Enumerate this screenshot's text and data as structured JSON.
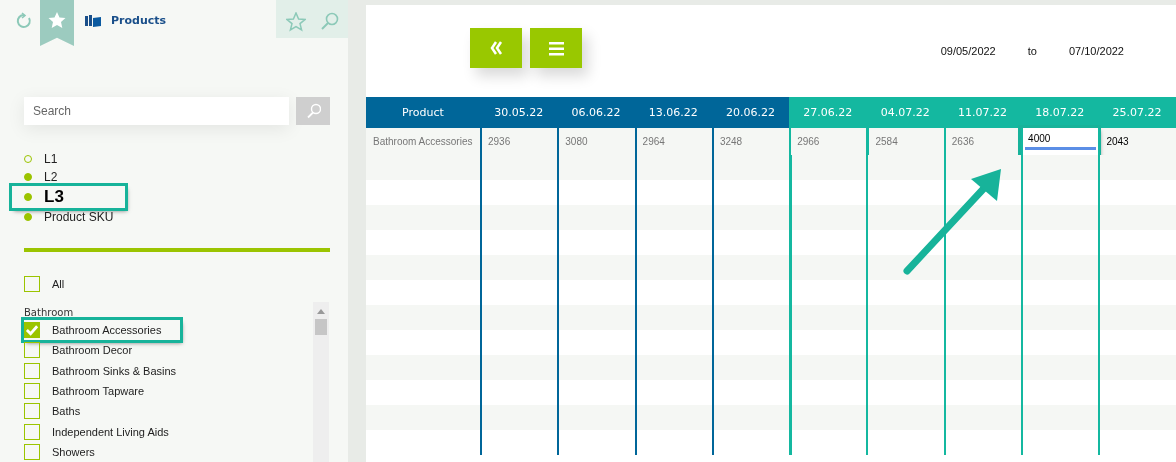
{
  "sidebar": {
    "title": "Products",
    "bookmark_selected": true,
    "search": {
      "placeholder": "Search"
    },
    "levels": [
      {
        "label": "L1",
        "filled": false,
        "selected": false,
        "highlighted": false
      },
      {
        "label": "L2",
        "filled": true,
        "selected": false,
        "highlighted": false
      },
      {
        "label": "L3",
        "filled": true,
        "selected": true,
        "highlighted": true
      },
      {
        "label": "Product SKU",
        "filled": true,
        "selected": false,
        "highlighted": false
      }
    ],
    "all": {
      "label": "All",
      "checked": false
    },
    "group": "Bathroom",
    "items": [
      {
        "label": "Bathroom Accessories",
        "checked": true,
        "highlighted": true
      },
      {
        "label": "Bathroom Decor",
        "checked": false,
        "highlighted": false
      },
      {
        "label": "Bathroom Sinks & Basins",
        "checked": false,
        "highlighted": false
      },
      {
        "label": "Bathroom Tapware",
        "checked": false,
        "highlighted": false
      },
      {
        "label": "Baths",
        "checked": false,
        "highlighted": false
      },
      {
        "label": "Independent Living Aids",
        "checked": false,
        "highlighted": false
      },
      {
        "label": "Showers",
        "checked": false,
        "highlighted": false
      }
    ]
  },
  "toolbar": {
    "from": "09/05/2022",
    "separator": "to",
    "to": "07/10/2022"
  },
  "table": {
    "columns": [
      {
        "label": "Product",
        "color": "#006699"
      },
      {
        "label": "30.05.22",
        "color": "#006699"
      },
      {
        "label": "06.06.22",
        "color": "#006699"
      },
      {
        "label": "13.06.22",
        "color": "#006699"
      },
      {
        "label": "20.06.22",
        "color": "#006699"
      },
      {
        "label": "27.06.22",
        "color": "#14b8a0"
      },
      {
        "label": "04.07.22",
        "color": "#14b8a0"
      },
      {
        "label": "11.07.22",
        "color": "#14b8a0"
      },
      {
        "label": "18.07.22",
        "color": "#14b8a0"
      },
      {
        "label": "25.07.22",
        "color": "#14b8a0"
      }
    ],
    "rows": [
      {
        "cells": [
          {
            "value": "Bathroom Accessories",
            "editing": false,
            "edited": false
          },
          {
            "value": "2936",
            "editing": false,
            "edited": false
          },
          {
            "value": "3080",
            "editing": false,
            "edited": false
          },
          {
            "value": "2964",
            "editing": false,
            "edited": false
          },
          {
            "value": "3248",
            "editing": false,
            "edited": false
          },
          {
            "value": "2966",
            "editing": false,
            "edited": false
          },
          {
            "value": "2584",
            "editing": false,
            "edited": false
          },
          {
            "value": "2636",
            "editing": false,
            "edited": false
          },
          {
            "value": "4000",
            "editing": true,
            "edited": true
          },
          {
            "value": "2043",
            "editing": false,
            "edited": true
          }
        ]
      }
    ]
  },
  "annotation_arrow": true
}
